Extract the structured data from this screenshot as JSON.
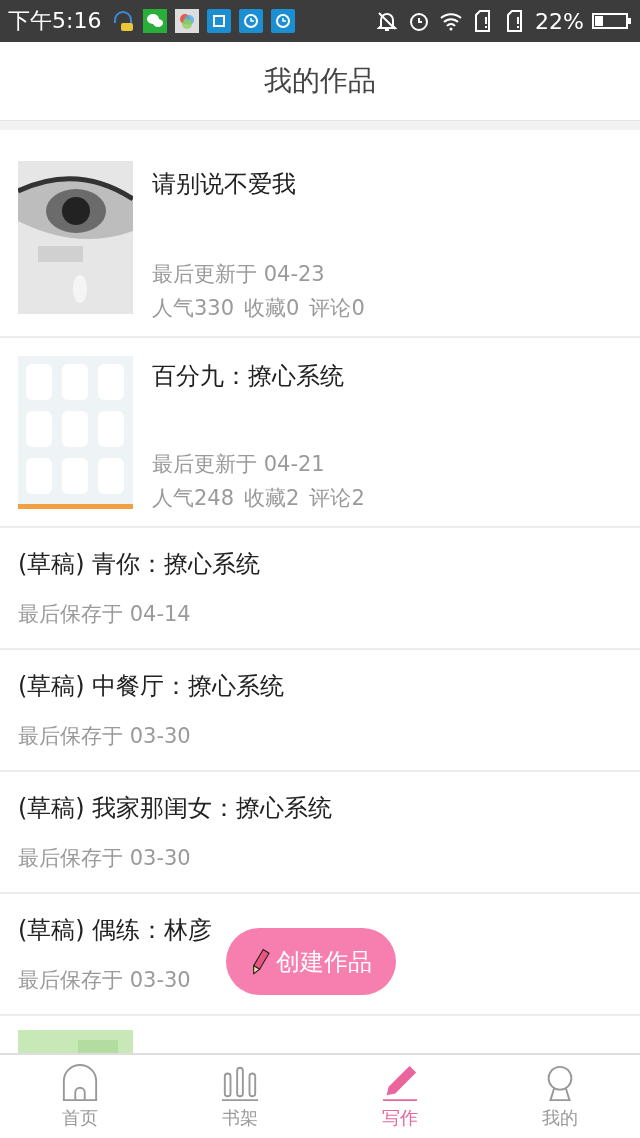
{
  "status_bar": {
    "time": "下午5:16",
    "battery": "22%"
  },
  "header": {
    "title": "我的作品"
  },
  "works": [
    {
      "kind": "published",
      "title": "请别说不爱我",
      "updated": "最后更新于 04-23",
      "stats": [
        "人气330",
        "收藏0",
        "评论0"
      ]
    },
    {
      "kind": "published",
      "title": "百分九：撩心系统",
      "updated": "最后更新于 04-21",
      "stats": [
        "人气248",
        "收藏2",
        "评论2"
      ]
    },
    {
      "kind": "draft",
      "title": "(草稿) 青你：撩心系统",
      "updated": "最后保存于 04-14"
    },
    {
      "kind": "draft",
      "title": "(草稿) 中餐厅：撩心系统",
      "updated": "最后保存于 03-30"
    },
    {
      "kind": "draft",
      "title": "(草稿) 我家那闺女：撩心系统",
      "updated": "最后保存于 03-30"
    },
    {
      "kind": "draft",
      "title": "(草稿) 偶练：林彦",
      "updated": "最后保存于 03-30"
    },
    {
      "kind": "picture"
    }
  ],
  "fab": {
    "label": "创建作品"
  },
  "tabs": [
    {
      "label": "首页",
      "selected": false
    },
    {
      "label": "书架",
      "selected": false
    },
    {
      "label": "写作",
      "selected": true
    },
    {
      "label": "我的",
      "selected": false
    }
  ]
}
